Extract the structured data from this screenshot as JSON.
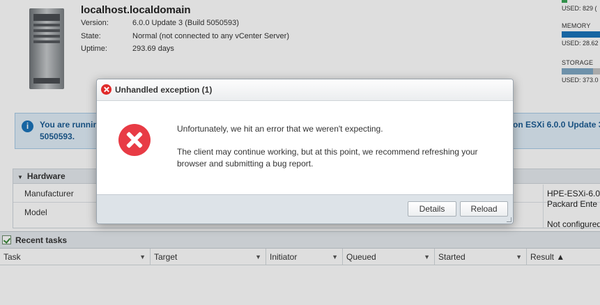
{
  "host": {
    "name": "localhost.localdomain",
    "fields": [
      {
        "key": "Version:",
        "value": "6.0.0 Update 3 (Build 5050593)"
      },
      {
        "key": "State:",
        "value": "Normal (not connected to any vCenter Server)"
      },
      {
        "key": "Uptime:",
        "value": "293.69 days"
      }
    ]
  },
  "resources": {
    "cpu_used": "USED: 829 (",
    "memory_label": "MEMORY",
    "memory_used": "USED: 28.62",
    "memory_fill": 0.92,
    "storage_label": "STORAGE",
    "storage_used": "USED: 373.0",
    "storage_fill": 0.75
  },
  "banner": {
    "line1": "You are running",
    "line1_right": "on ESXi 6.0.0 Update 3",
    "line2": "5050593."
  },
  "hardware": {
    "header": "Hardware",
    "rows": [
      {
        "key": "Manufacturer",
        "value_line1": "HPE-ESXi-6.0",
        "value_line2": "Packard Ente"
      },
      {
        "key": "Model",
        "value_line1": "",
        "value_line2": ""
      },
      {
        "key": "",
        "value_line1": "Not configured",
        "value_line2": ""
      }
    ]
  },
  "recent_tasks": {
    "title": "Recent tasks",
    "columns": [
      "Task",
      "Target",
      "Initiator",
      "Queued",
      "Started",
      "Result ▲"
    ]
  },
  "dialog": {
    "title": "Unhandled exception (1)",
    "message1": "Unfortunately, we hit an error that we weren't expecting.",
    "message2": "The client may continue working, but at this point, we recommend refreshing your browser and submitting a bug report.",
    "details_label": "Details",
    "reload_label": "Reload"
  }
}
